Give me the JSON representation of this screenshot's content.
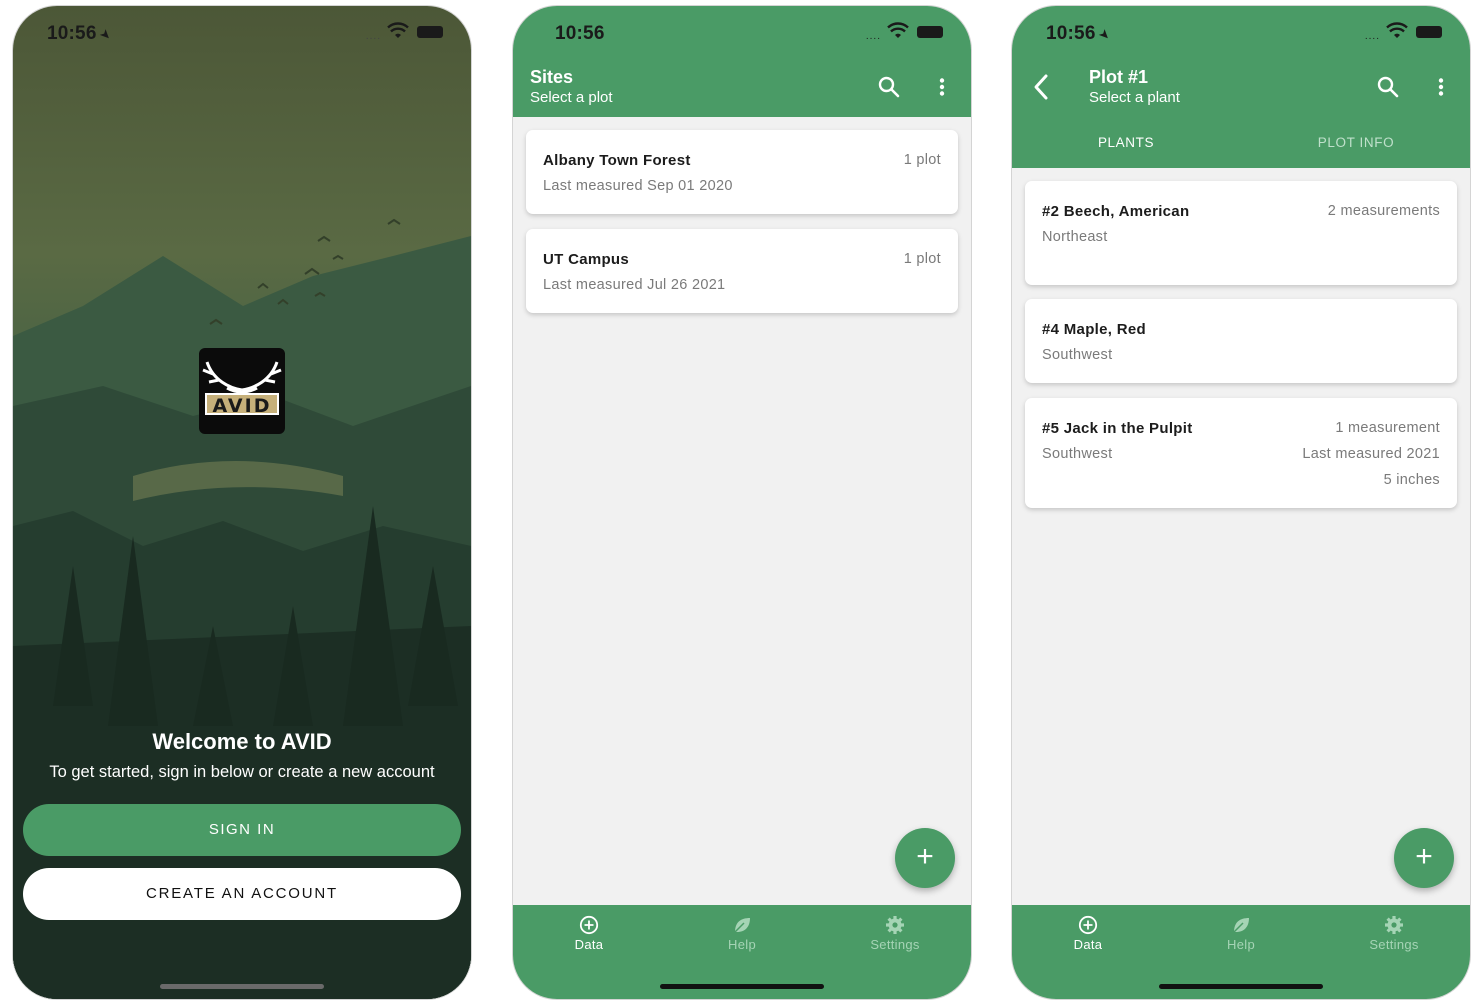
{
  "status_bar": {
    "time": "10:56",
    "signal": "...."
  },
  "colors": {
    "brand_green": "#4a9b66",
    "background": "#f1f1f1"
  },
  "welcome": {
    "logo_text": "AVID",
    "title": "Welcome to AVID",
    "subtitle": "To get started, sign in below or create a new account",
    "sign_in_label": "SIGN IN",
    "create_account_label": "CREATE AN ACCOUNT"
  },
  "sites": {
    "title": "Sites",
    "subtitle": "Select a plot",
    "items": [
      {
        "name": "Albany Town Forest",
        "measured": "Last measured Sep 01 2020",
        "count": "1 plot"
      },
      {
        "name": "UT Campus",
        "measured": "Last measured Jul 26 2021",
        "count": "1 plot"
      }
    ],
    "fab_label": "+"
  },
  "plot": {
    "title": "Plot #1",
    "subtitle": "Select a plant",
    "tabs": [
      "PLANTS",
      "PLOT INFO"
    ],
    "plants": [
      {
        "name": "#2 Beech, American",
        "direction": "Northeast",
        "measurements": "2 measurements"
      },
      {
        "name": "#4 Maple, Red",
        "direction": "Southwest"
      },
      {
        "name": "#5 Jack in the Pulpit",
        "direction": "Southwest",
        "measurements": "1 measurement",
        "last_measured": "Last measured 2021",
        "size": "5 inches"
      }
    ],
    "fab_label": "+"
  },
  "bottom_nav": [
    {
      "label": "Data",
      "icon": "add-circle-icon"
    },
    {
      "label": "Help",
      "icon": "leaf-icon"
    },
    {
      "label": "Settings",
      "icon": "gear-icon"
    }
  ]
}
